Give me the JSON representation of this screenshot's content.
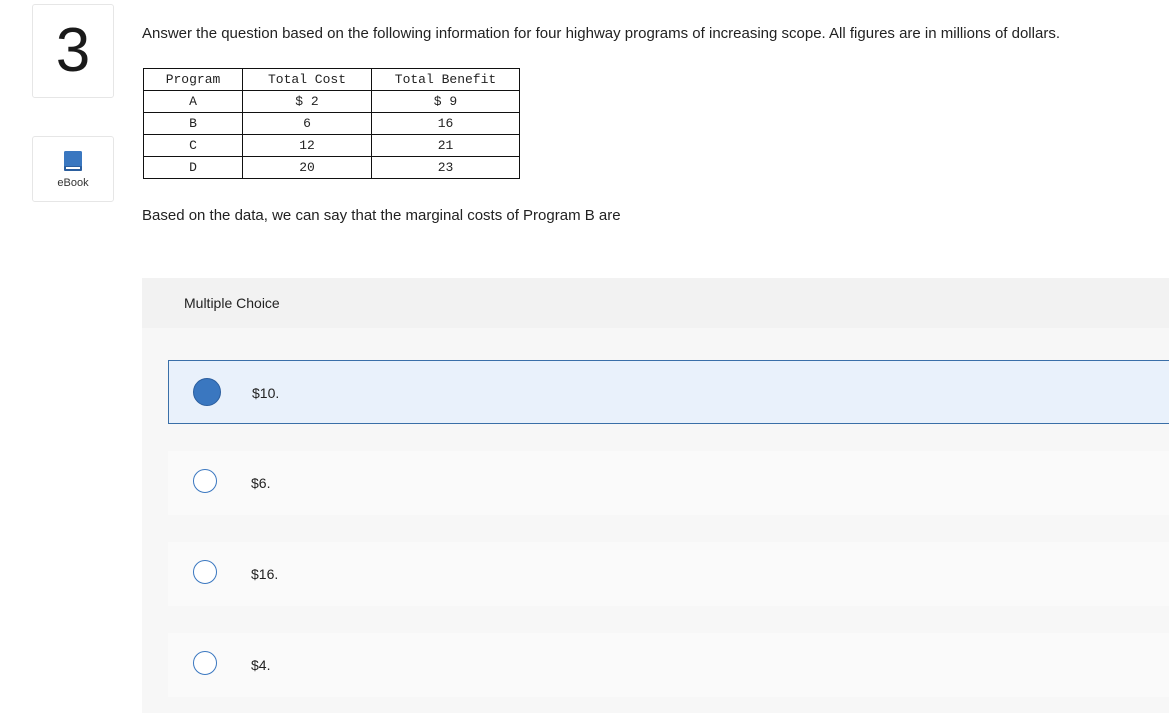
{
  "question_number": "3",
  "ebook": {
    "label": "eBook",
    "icon": "book-icon"
  },
  "prompt": "Answer the question based on the following information for four highway programs of increasing scope. All figures are in millions of dollars.",
  "table": {
    "headers": [
      "Program",
      "Total Cost",
      "Total Benefit"
    ],
    "rows": [
      [
        "A",
        "$ 2",
        "$ 9"
      ],
      [
        "B",
        "6",
        "16"
      ],
      [
        "C",
        "12",
        "21"
      ],
      [
        "D",
        "20",
        "23"
      ]
    ]
  },
  "question": "Based on the data, we can say that the marginal costs of Program B are",
  "multiple_choice": {
    "header": "Multiple Choice",
    "options": [
      {
        "label": "$10.",
        "selected": true
      },
      {
        "label": "$6.",
        "selected": false
      },
      {
        "label": "$16.",
        "selected": false
      },
      {
        "label": "$4.",
        "selected": false
      }
    ]
  },
  "colors": {
    "accent": "#3a77c0",
    "selected_bg": "#e9f1fb",
    "panel_bg": "#f2f2f2"
  }
}
